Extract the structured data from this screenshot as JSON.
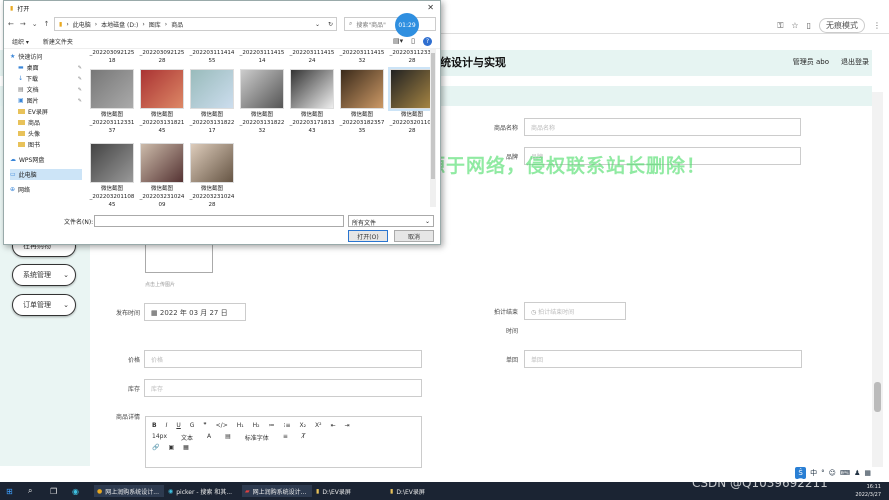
{
  "browser": {
    "profile": "无痕模式"
  },
  "app": {
    "title": "统设计与实现",
    "user": "管理员 abo",
    "logout": "退出登录"
  },
  "sidebar": {
    "items": [
      {
        "label": "在再购物"
      },
      {
        "label": "系统管理"
      },
      {
        "label": "订单管理"
      }
    ]
  },
  "form": {
    "product_name_label": "商品名称",
    "product_name_placeholder": "商品名称",
    "category_label": "品牌",
    "category_placeholder": "品牌",
    "upload_hint": "点击上传图片",
    "publish_label": "发布时间",
    "publish_value": "2022 年 03 月 27 日",
    "end_label_1": "拍计结束",
    "end_label_2": "时间",
    "end_placeholder": "拍计结束时间",
    "price_label": "价格",
    "price_placeholder": "价格",
    "unit_label": "单回",
    "unit_placeholder": "单回",
    "stock_label": "库存",
    "stock_placeholder": "库存",
    "detail_label": "商品详情"
  },
  "editor": {
    "row1": [
      "B",
      "I",
      "U",
      "G",
      "❞",
      "</>",
      "H₁",
      "H₂",
      "≔",
      "⁝≡",
      "X₂",
      "X²",
      "⇤",
      "⇥"
    ],
    "row2": [
      "14px",
      "文本",
      "A",
      "▤",
      "标准字体",
      "≡",
      "T̸"
    ],
    "row3": [
      "🔗",
      "▣",
      "▦"
    ]
  },
  "watermark": "图片来源于网络，侵权联系站长删除！",
  "dialog": {
    "title": "打开",
    "path": [
      "此电脑",
      "本地磁盘 (D:)",
      "图库",
      "商品"
    ],
    "search_placeholder": "搜索\"商品\"",
    "clock": "01:29",
    "organize": "组织 ▾",
    "new_folder": "新建文件夹",
    "tree": [
      {
        "label": "快速访问",
        "type": "star"
      },
      {
        "label": "桌面",
        "type": "desk"
      },
      {
        "label": "下载",
        "type": "down"
      },
      {
        "label": "文档",
        "type": "doc"
      },
      {
        "label": "图片",
        "type": "pic"
      },
      {
        "label": "EV录屏",
        "type": "folder"
      },
      {
        "label": "商品",
        "type": "folder"
      },
      {
        "label": "头像",
        "type": "folder"
      },
      {
        "label": "图书",
        "type": "folder"
      },
      {
        "label": "WPS网盘",
        "type": "cloud"
      },
      {
        "label": "此电脑",
        "type": "pc"
      },
      {
        "label": "网络",
        "type": "net"
      }
    ],
    "top_row": [
      "_202203092125\n18",
      "_202203092125\n28",
      "_202203111414\n55",
      "_202203111415\n14",
      "_202203111415\n24",
      "_202203111415\n32",
      "_202203112331\n28"
    ],
    "files_row1": [
      {
        "name": "微信截图",
        "id": "_202203112331\n37"
      },
      {
        "name": "微信截图",
        "id": "_202203131821\n45"
      },
      {
        "name": "微信截图",
        "id": "_202203131822\n17"
      },
      {
        "name": "微信截图",
        "id": "_202203131822\n32"
      },
      {
        "name": "微信截图",
        "id": "_202203171813\n43"
      },
      {
        "name": "微信截图",
        "id": "_202203182357\n35"
      },
      {
        "name": "微信截图",
        "id": "_202203201108\n28"
      }
    ],
    "files_row2": [
      {
        "name": "微信截图",
        "id": "_202203201108\n45"
      },
      {
        "name": "微信截图",
        "id": "_202203231024\n09"
      },
      {
        "name": "微信截图",
        "id": "_202203231024\n28"
      }
    ],
    "filename_label": "文件名(N):",
    "filetype": "所有文件",
    "open": "打开(O)",
    "cancel": "取消"
  },
  "taskbar": {
    "items": [
      "网上润购系统设计...",
      "picker - 搜索 和其...",
      "网上润购系统设计...",
      "D:\\EV录屏",
      "D:\\EV录屏"
    ],
    "csdn": "CSDN @Q1039692211",
    "time": "16:11",
    "date": "2022/3/27"
  },
  "ime": [
    "中",
    "°",
    "☺",
    "⌨",
    "♟",
    "▦"
  ]
}
